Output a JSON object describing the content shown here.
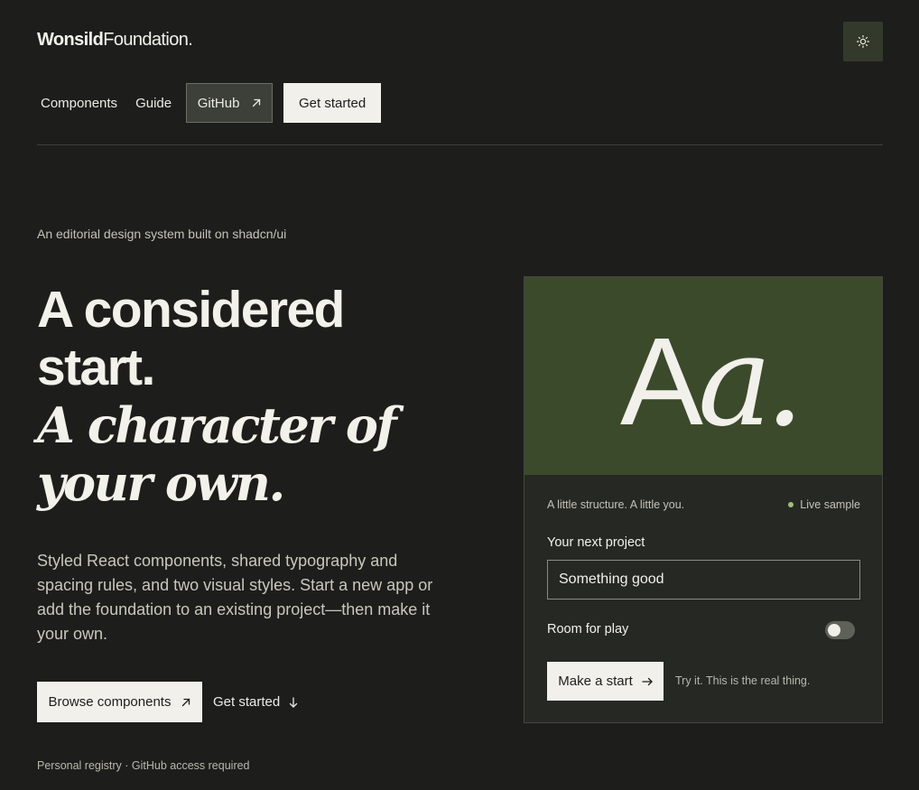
{
  "header": {
    "brand_bold": "Wonsild",
    "brand_regular": "Foundation.",
    "theme_icon": "sun-icon"
  },
  "nav": {
    "components": "Components",
    "guide": "Guide",
    "github": "GitHub",
    "get_started": "Get started"
  },
  "hero": {
    "eyebrow": "An editorial design system built on shadcn/ui",
    "headline_line1": "A considered",
    "headline_line2": "start.",
    "headline_italic1": "A character of",
    "headline_italic2": "your own.",
    "lead": "Styled React components, shared typography and spacing rules, and two visual styles. Start a new app or add the foundation to an existing project—then make it your own.",
    "browse": "Browse components",
    "get_started": "Get started",
    "footnote": "Personal registry · GitHub access required"
  },
  "card": {
    "specimen_upright": "A",
    "specimen_italic": "a.",
    "tagline": "A little structure. A little you.",
    "live": "Live sample",
    "field_label": "Your next project",
    "field_value": "Something good",
    "toggle_label": "Room for play",
    "toggle_on": false,
    "button": "Make a start",
    "hint": "Try it. This is the real thing."
  },
  "colors": {
    "background": "#1d1e1c",
    "accent_green": "#3b4a2b",
    "cream": "#f1f0ea",
    "live_dot": "#9fbf7c"
  }
}
